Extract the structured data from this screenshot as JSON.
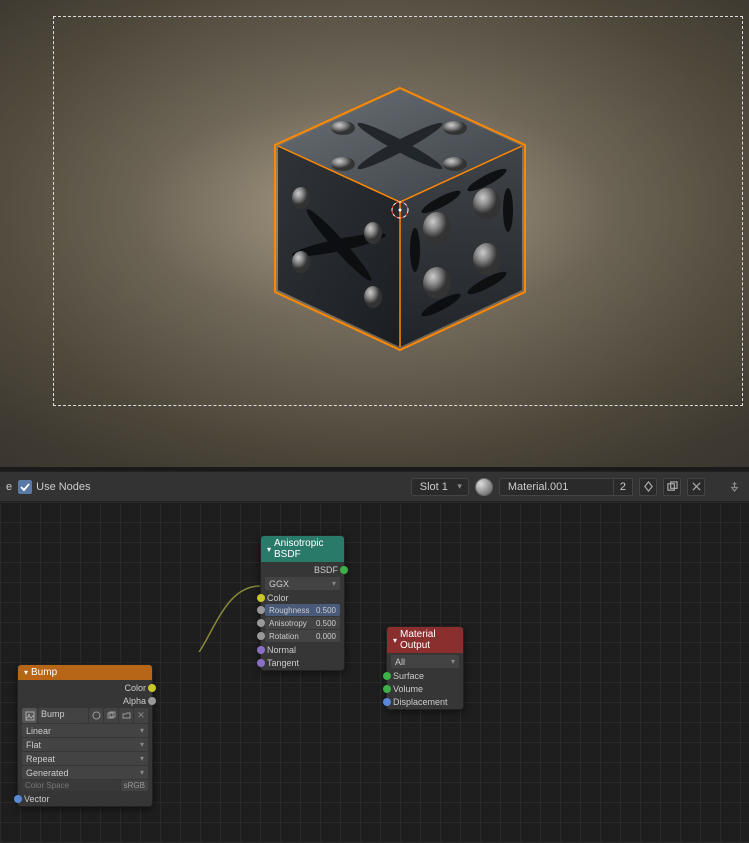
{
  "toolbar": {
    "use_nodes_label": "Use Nodes",
    "use_nodes_checked": true,
    "slot_label": "Slot 1",
    "material_name": "Material.001",
    "material_users": "2"
  },
  "nodes": {
    "image_texture": {
      "title": "Bump",
      "outputs": {
        "color": "Color",
        "alpha": "Alpha"
      },
      "image_name": "Bump",
      "interpolation": "Linear",
      "projection": "Flat",
      "extension": "Repeat",
      "texcoord": "Generated",
      "colorspace_label": "Color Space",
      "colorspace_value": "sRGB",
      "inputs": {
        "vector": "Vector"
      }
    },
    "anisotropic": {
      "title": "Anisotropic BSDF",
      "output": "BSDF",
      "distribution": "GGX",
      "color_label": "Color",
      "roughness_label": "Roughness",
      "roughness_value": "0.500",
      "anisotropy_label": "Anisotropy",
      "anisotropy_value": "0.500",
      "rotation_label": "Rotation",
      "rotation_value": "0.000",
      "normal_label": "Normal",
      "tangent_label": "Tangent"
    },
    "output": {
      "title": "Material Output",
      "target": "All",
      "surface": "Surface",
      "volume": "Volume",
      "displacement": "Displacement"
    }
  }
}
